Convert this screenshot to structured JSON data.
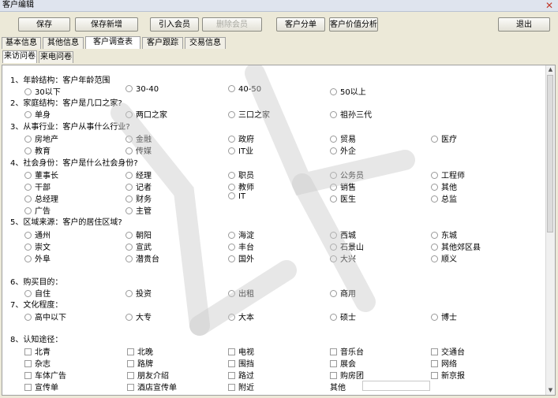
{
  "window": {
    "title": "客户编辑",
    "close": "✕"
  },
  "toolbar": {
    "save": "保存",
    "save_new": "保存新增",
    "import_member": "引入会员",
    "delete_member": "删除会员",
    "segment": "客户分单",
    "value_analysis": "客户价值分析",
    "exit": "退出"
  },
  "tabs": [
    "基本信息",
    "其他信息",
    "客户调查表",
    "客户跟踪",
    "交易信息"
  ],
  "subtabs": [
    "来访问卷",
    "来电问卷"
  ],
  "questions": {
    "q1": {
      "title": "1、年龄结构：客户年龄范围",
      "options": [
        "30以下",
        "30-40",
        "40-50",
        "50以上"
      ]
    },
    "q2": {
      "title": "2、家庭结构：客户是几口之家?",
      "options": [
        "单身",
        "两口之家",
        "三口之家",
        "祖孙三代"
      ]
    },
    "q3": {
      "title": "3、从事行业：客户从事什么行业?",
      "options": [
        "房地产",
        "金融",
        "政府",
        "贸易",
        "医疗",
        "教育",
        "传媒",
        "IT业",
        "外企"
      ]
    },
    "q4": {
      "title": "4、社会身份：客户是什么社会身份?",
      "options": [
        "董事长",
        "经理",
        "职员",
        "公务员",
        "工程师",
        "干部",
        "记者",
        "教师",
        "销售",
        "其他",
        "总经理",
        "财务",
        "IT",
        "医生",
        "总监",
        "广告",
        "主管"
      ]
    },
    "q5": {
      "title": "5、区域来源：客户的居住区域?",
      "options": [
        "通州",
        "朝阳",
        "海淀",
        "西城",
        "东城",
        "崇文",
        "宣武",
        "丰台",
        "石景山",
        "其他郊区县",
        "外阜",
        "潜贵台",
        "国外",
        "大兴",
        "顺义"
      ]
    },
    "q6": {
      "title": "6、购买目的：",
      "options": [
        "自住",
        "投资",
        "出租",
        "商用"
      ]
    },
    "q7": {
      "title": "7、文化程度：",
      "options": [
        "高中以下",
        "大专",
        "大本",
        "硕士",
        "博士"
      ]
    },
    "q8": {
      "title": "8、认知途径：",
      "options": [
        "北青",
        "北晚",
        "电视",
        "音乐台",
        "交通台",
        "杂志",
        "路牌",
        "围挡",
        "展会",
        "网络",
        "车体广告",
        "朋友介绍",
        "路过",
        "购房团",
        "新京报",
        "宣传单",
        "酒店宣传单",
        "附近"
      ],
      "other_label": "其他"
    }
  }
}
